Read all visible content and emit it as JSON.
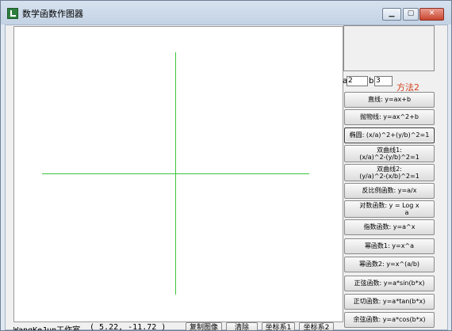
{
  "window": {
    "title": "数学函数作图器",
    "controls": {
      "minimize": "▁",
      "maximize": "▢",
      "close": "✕"
    }
  },
  "params": {
    "a_label": "a",
    "a_value": "2",
    "b_label": "b",
    "b_value": "3",
    "method_label": "方法2"
  },
  "buttons": [
    {
      "text": "直线: y=ax+b"
    },
    {
      "text": "抛物线: y=ax^2+b"
    },
    {
      "text": "椭圆: (x/a)^2+(y/b)^2=1"
    },
    {
      "line1": "双曲线1:",
      "line2": "(x/a)^2-(y/b)^2=1"
    },
    {
      "line1": "双曲线2:",
      "line2": "(y/a)^2-(x/b)^2=1"
    },
    {
      "text": "反比例函数: y=a/x"
    },
    {
      "line1": "对数函数: y = Log  x",
      "line2": "a"
    },
    {
      "text": "指数函数: y=a^x"
    },
    {
      "text": "幂函数1: y=x^a"
    },
    {
      "text": "幂函数2: y=x^(a/b)"
    },
    {
      "text": "正弦函数: y=a*sin(b*x)"
    },
    {
      "text": "正切函数: y=a*tan(b*x)"
    },
    {
      "text": "余弦函数: y=a*cos(b*x)"
    }
  ],
  "status": {
    "author": "WangKeJun工作室",
    "coords": "( 5.22, -11.72 )"
  },
  "bottom_buttons": {
    "copy": "复制图像",
    "clear": "清除",
    "coord1": "坐标系1",
    "coord2": "坐标系2"
  },
  "colors": {
    "axis": "#3cc63c",
    "method_text": "#d2401c"
  }
}
